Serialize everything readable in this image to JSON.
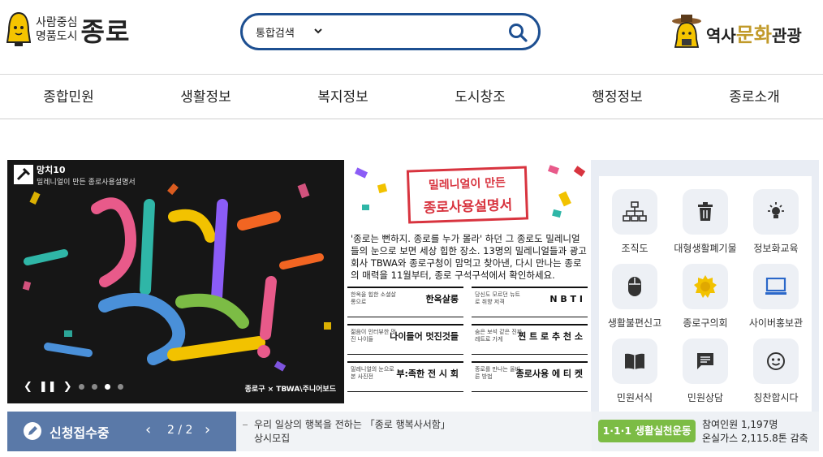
{
  "header": {
    "logo_sub_line1": "사람중심",
    "logo_sub_line2": "명품도시",
    "logo_main": "종로",
    "search": {
      "category": "통합검색",
      "placeholder": ""
    },
    "culture_prefix": "역사",
    "culture_highlight": "문화",
    "culture_suffix": "관광"
  },
  "nav": {
    "items": [
      "종합민원",
      "생활정보",
      "복지정보",
      "도시창조",
      "행정정보",
      "종로소개"
    ]
  },
  "banner": {
    "tag": "망치10",
    "caption": "밀레니얼이 만든 종로사용설명서",
    "brand": "종로구 × TBWA\\주니어보드"
  },
  "promo": {
    "title1": "밀레니얼이 만든",
    "title2": "종로사용설명서",
    "desc": "'종로는 뻔하지. 종로를 누가 몰라' 하던 그 종로도 밀레니얼들의 눈으로 보면 세상 힙한 장소. 13명의 밀레니얼들과 광고회사 TBWA와 종로구청이 맘먹고 찾아낸, 다시 만나는 종로의 매력을 11월부터, 종로 구석구석에서 확인하세요.",
    "cells": [
      {
        "small": "한옥을 힙한 소셜살롱으로",
        "big": "한옥살롱"
      },
      {
        "small": "당신도 모르던 뉴트로 취향 저격",
        "big": "N B T I"
      },
      {
        "small": "젊음이 인터뷰한 멋진 나이들",
        "big": "나이들어 멋진것들"
      },
      {
        "small": "숨은 보석 같은 진짜 레트로 가게",
        "big": "찐 트 로 추 천 소"
      },
      {
        "small": "밀레니얼의 눈으로 본 사진전",
        "big": "부:족한 전 시 회"
      },
      {
        "small": "종로를 만나는 올바른 방법",
        "big": "종로사용 에 티 켓"
      }
    ]
  },
  "quick": {
    "items": [
      {
        "label": "조직도",
        "icon": "org-chart-icon"
      },
      {
        "label": "대형생활폐기물",
        "icon": "trash-icon"
      },
      {
        "label": "정보화교육",
        "icon": "lightbulb-icon"
      },
      {
        "label": "생활불편신고",
        "icon": "mouse-icon"
      },
      {
        "label": "종로구의회",
        "icon": "council-emblem-icon"
      },
      {
        "label": "사이버홍보관",
        "icon": "monitor-icon"
      },
      {
        "label": "민원서식",
        "icon": "book-icon"
      },
      {
        "label": "민원상담",
        "icon": "chat-icon"
      },
      {
        "label": "칭찬합시다",
        "icon": "smile-icon"
      }
    ]
  },
  "status": {
    "label": "신청접수중",
    "page": "2 / 2"
  },
  "notice": {
    "line1": "우리 일상의 행복을 전하는 「종로 행복사서함」",
    "line2": "상시모집"
  },
  "campaign": {
    "button": "1·1·1 생활실천운동",
    "stat1": "참여인원 1,197명",
    "stat2": "온실가스 2,115.8톤 감축"
  },
  "colors": {
    "primary": "#1d4f91",
    "status_bar": "#5a79a8",
    "campaign_green": "#7cbc45",
    "promo_red": "#d8343f"
  }
}
